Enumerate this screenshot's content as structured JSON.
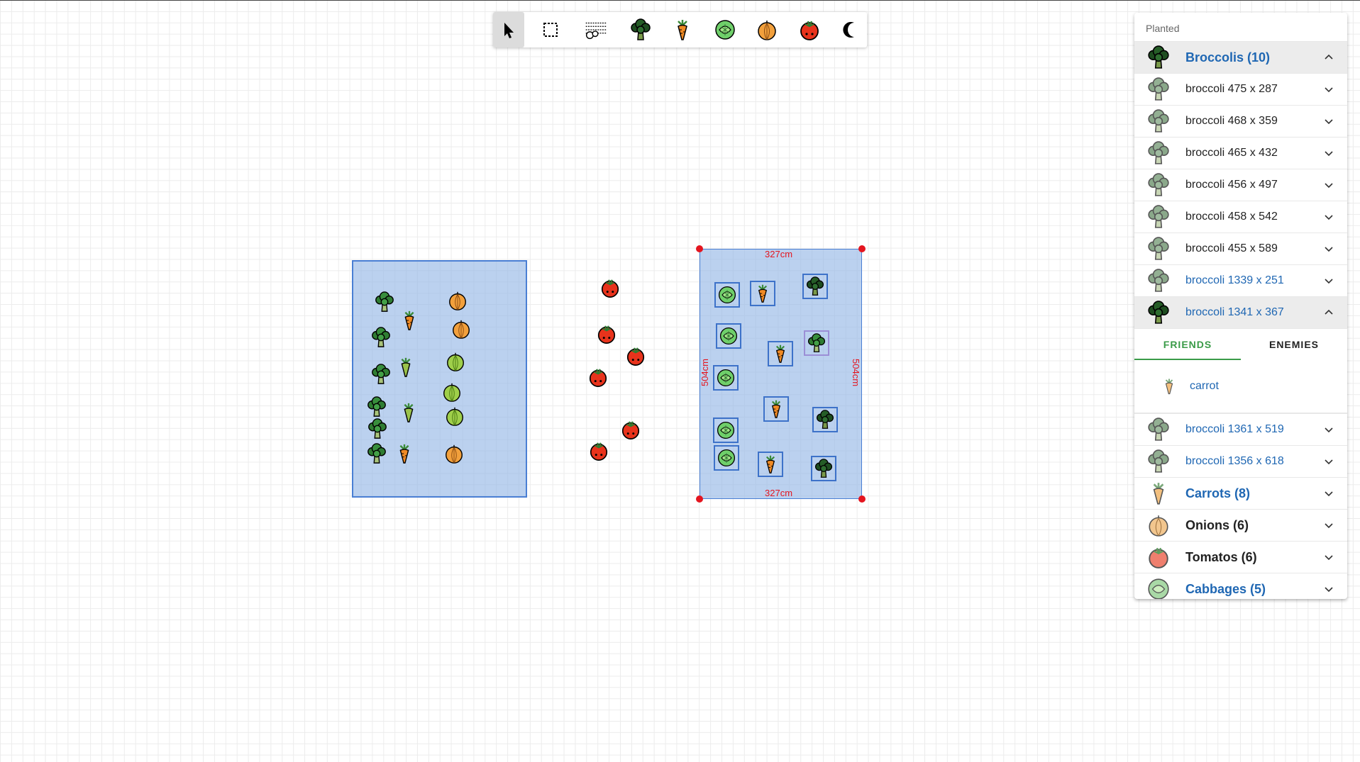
{
  "toolbar": {
    "tools": [
      {
        "name": "select",
        "icon": "pointer-icon"
      },
      {
        "name": "marquee",
        "icon": "marquee-icon"
      },
      {
        "name": "bed",
        "icon": "garden-bed-icon"
      },
      {
        "name": "broccoli",
        "icon": "broccoli-icon"
      },
      {
        "name": "carrot",
        "icon": "carrot-icon"
      },
      {
        "name": "cabbage",
        "icon": "cabbage-icon"
      },
      {
        "name": "onion",
        "icon": "onion-icon"
      },
      {
        "name": "tomato",
        "icon": "tomato-icon"
      },
      {
        "name": "dark-mode",
        "icon": "moon-icon"
      }
    ],
    "active": "select"
  },
  "canvas": {
    "selected_bed": {
      "width_label": "327cm",
      "height_label": "504cm"
    }
  },
  "panel": {
    "title": "Planted",
    "groups": {
      "broccolis": {
        "label": "Broccolis (10)",
        "items": [
          "broccoli 475 x 287",
          "broccoli 468 x 359",
          "broccoli 465 x 432",
          "broccoli 456 x 497",
          "broccoli 458 x 542",
          "broccoli 455 x 589",
          "broccoli 1339 x 251",
          "broccoli 1341 x 367",
          "broccoli 1361 x 519",
          "broccoli 1356 x 618"
        ]
      },
      "carrots": {
        "label": "Carrots (8)"
      },
      "onions": {
        "label": "Onions (6)"
      },
      "tomatos": {
        "label": "Tomatos (6)"
      },
      "cabbages": {
        "label": "Cabbages (5)"
      }
    },
    "tabs": {
      "friends": "FRIENDS",
      "enemies": "ENEMIES"
    },
    "friends_list": [
      "carrot"
    ]
  },
  "colors": {
    "accent_blue": "#1f67b3",
    "accent_green": "#3a9b48",
    "handle_red": "#e4151f",
    "bed_fill": "#96b9e6",
    "bed_border": "#4a7fd4"
  }
}
